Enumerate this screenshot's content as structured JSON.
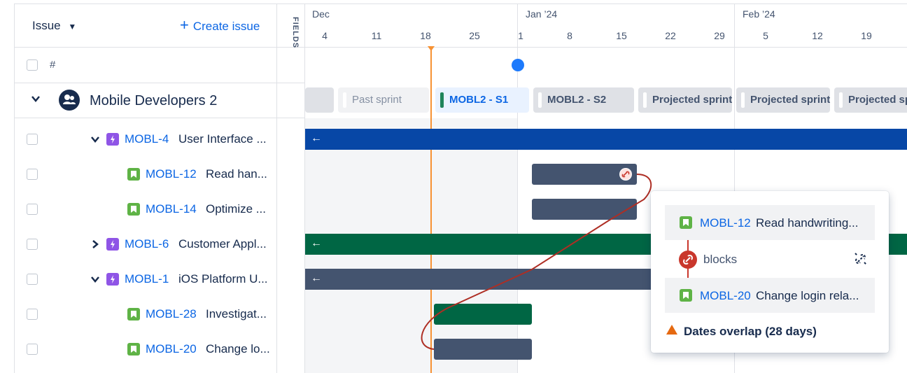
{
  "header": {
    "issue_label": "Issue",
    "create_issue_label": "Create issue",
    "fields_label": "FIELDS",
    "hash_label": "#"
  },
  "timeline": {
    "months": [
      "Dec",
      "Jan ’24",
      "Feb ’24"
    ],
    "days": [
      "4",
      "11",
      "18",
      "25",
      "1",
      "8",
      "15",
      "22",
      "29",
      "5",
      "12",
      "19"
    ]
  },
  "team": {
    "name": "Mobile Developers 2"
  },
  "sprints": [
    "Past sprint",
    "MOBL2 - S1",
    "MOBL2 - S2",
    "Projected sprint",
    "Projected sprint",
    "Projected sprint"
  ],
  "rows": [
    {
      "key": "MOBL-4",
      "summary": "User Interface ...",
      "type": "epic",
      "expand": "down"
    },
    {
      "key": "MOBL-12",
      "summary": "Read han...",
      "type": "story"
    },
    {
      "key": "MOBL-14",
      "summary": "Optimize ...",
      "type": "story"
    },
    {
      "key": "MOBL-6",
      "summary": "Customer Appl...",
      "type": "epic",
      "expand": "right"
    },
    {
      "key": "MOBL-1",
      "summary": "iOS Platform U...",
      "type": "epic",
      "expand": "down"
    },
    {
      "key": "MOBL-28",
      "summary": "Investigat...",
      "type": "story"
    },
    {
      "key": "MOBL-20",
      "summary": "Change lo...",
      "type": "story"
    }
  ],
  "popup": {
    "from_key": "MOBL-12",
    "from_summary": "Read handwriting...",
    "relation": "blocks",
    "to_key": "MOBL-20",
    "to_summary": "Change login rela...",
    "warning": "Dates overlap (28 days)"
  },
  "colors": {
    "blue_bar": "#0747a6",
    "green_bar": "#006644",
    "slate_bar": "#44546f",
    "today_line": "#f79233",
    "link_red": "#c9372c"
  }
}
